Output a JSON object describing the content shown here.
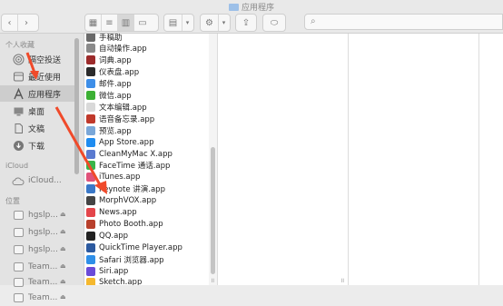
{
  "window": {
    "title": "应用程序"
  },
  "toolbar": {
    "back_icon": "chevron-left-icon",
    "forward_icon": "chevron-right-icon",
    "view_modes": [
      "icon-view",
      "list-view",
      "column-view",
      "gallery-view"
    ],
    "active_view": "column-view",
    "search": {
      "placeholder": ""
    }
  },
  "sidebar": {
    "favorites_heading": "个人收藏",
    "favorites": [
      {
        "label": "隔空投送",
        "icon": "airdrop-icon"
      },
      {
        "label": "最近使用",
        "icon": "clock-icon"
      },
      {
        "label": "应用程序",
        "icon": "applications-icon",
        "selected": true
      },
      {
        "label": "桌面",
        "icon": "desktop-icon"
      },
      {
        "label": "文稿",
        "icon": "document-icon"
      },
      {
        "label": "下载",
        "icon": "download-icon"
      }
    ],
    "icloud_heading": "iCloud",
    "icloud": [
      {
        "label": "iCloud...",
        "icon": "cloud-icon"
      }
    ],
    "locations_heading": "位置",
    "locations": [
      {
        "label": "hgslp...",
        "icon": "drive-icon"
      },
      {
        "label": "hgslp...",
        "icon": "drive-icon"
      },
      {
        "label": "hgslp...",
        "icon": "drive-icon"
      },
      {
        "label": "Team...",
        "icon": "drive-icon"
      },
      {
        "label": "Team...",
        "icon": "drive-icon"
      },
      {
        "label": "Team...",
        "icon": "drive-icon"
      }
    ]
  },
  "files": [
    {
      "name": "手稿助",
      "color": "#6a6a6a"
    },
    {
      "name": "自动操作.app",
      "color": "#8a8a8a"
    },
    {
      "name": "词典.app",
      "color": "#9c2b2b"
    },
    {
      "name": "仪表盘.app",
      "color": "#2b2b2b"
    },
    {
      "name": "邮件.app",
      "color": "#3d8ee8"
    },
    {
      "name": "微信.app",
      "color": "#3cb034"
    },
    {
      "name": "文本编辑.app",
      "color": "#d9d9d9"
    },
    {
      "name": "语音备忘录.app",
      "color": "#c0392b"
    },
    {
      "name": "预览.app",
      "color": "#7aa7d8"
    },
    {
      "name": "App Store.app",
      "color": "#1f8cf0"
    },
    {
      "name": "CleanMyMac X.app",
      "color": "#5a7ad0"
    },
    {
      "name": "FaceTime 通话.app",
      "color": "#39b54a"
    },
    {
      "name": "iTunes.app",
      "color": "#e0527a"
    },
    {
      "name": "Keynote 讲演.app",
      "color": "#3a78c8"
    },
    {
      "name": "MorphVOX.app",
      "color": "#444444"
    },
    {
      "name": "News.app",
      "color": "#e4454a"
    },
    {
      "name": "Photo Booth.app",
      "color": "#b8402c"
    },
    {
      "name": "QQ.app",
      "color": "#222222"
    },
    {
      "name": "QuickTime Player.app",
      "color": "#2c5aa0"
    },
    {
      "name": "Safari 浏览器.app",
      "color": "#2f8fe8"
    },
    {
      "name": "Siri.app",
      "color": "#6a4bd8"
    },
    {
      "name": "Sketch.app",
      "color": "#f5b82e"
    }
  ],
  "annotations": {
    "arrow_color": "#f04a2a"
  }
}
